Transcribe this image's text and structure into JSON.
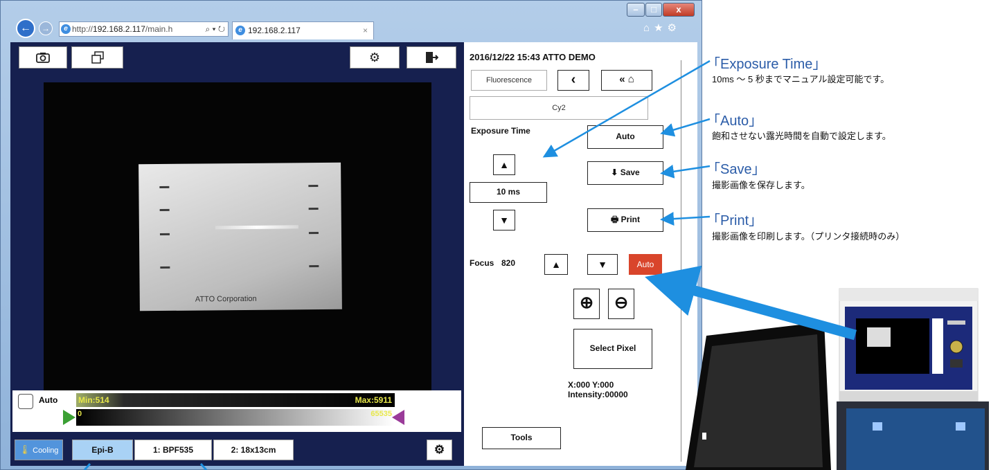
{
  "browser": {
    "url_prefix": "http://",
    "url_host": "192.168.2.117",
    "url_suffix": "/main.h",
    "tab_title": "192.168.2.117",
    "tab_close": "×"
  },
  "viewer": {
    "gel_label": "ATTO Corporation",
    "auto_label": "Auto",
    "min_label": "Min:514",
    "max_label": "Max:5911",
    "range_min": "0",
    "range_max": "65535",
    "bottom_buttons": {
      "cooling": "Cooling",
      "epi": "Epi-B",
      "filter": "1: BPF535",
      "size": "2: 18x13cm"
    }
  },
  "panel": {
    "datetime": "2016/12/22 15:43",
    "demo": "ATTO DEMO",
    "mode": "Fluorescence",
    "channel": "Cy2",
    "exposure_label": "Exposure Time",
    "exposure_value": "10 ms",
    "auto_button": "Auto",
    "save_button": "Save",
    "print_button": "Print",
    "focus_label": "Focus",
    "focus_value": "820",
    "focus_auto": "Auto",
    "select_pixel": "Select Pixel",
    "coords": "X:000 Y:000",
    "intensity": "Intensity:00000",
    "tools": "Tools"
  },
  "annotations": [
    {
      "title": "「Exposure Time」",
      "desc": "10ms ～ 5 秒までマニュアル設定可能です。"
    },
    {
      "title": "「Auto」",
      "desc": "飽和させない露光時間を自動で設定します。"
    },
    {
      "title": "「Save」",
      "desc": "撮影画像を保存します。"
    },
    {
      "title": "「Print」",
      "desc": "撮影画像を印刷します。（プリンタ接続時のみ）"
    }
  ],
  "colors": {
    "accent": "#2b5ca8",
    "arrow": "#1e8fe0",
    "focus_auto": "#d9452b",
    "epi_selected": "#a9d2f5",
    "cooling": "#5294dc"
  }
}
